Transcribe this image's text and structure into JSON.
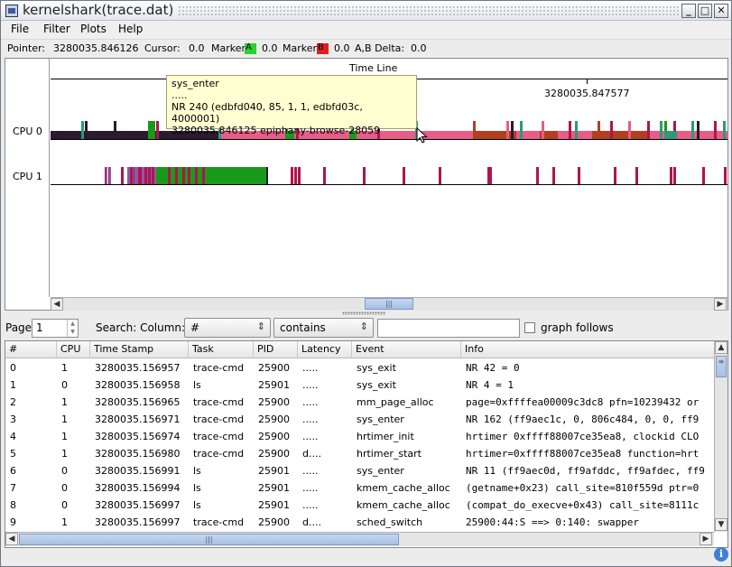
{
  "window": {
    "title": "kernelshark(trace.dat)",
    "controls": {
      "minimize": "_",
      "maximize": "□",
      "close": "✕"
    }
  },
  "menubar": {
    "items": [
      "File",
      "Filter",
      "Plots",
      "Help"
    ]
  },
  "pointer_bar": {
    "pointer_label": "Pointer:",
    "pointer_value": "3280035.846126",
    "cursor_label": "Cursor:",
    "cursor_value": "0.0",
    "marker_a_label": "Marker",
    "marker_a_letter": "A",
    "marker_a_value": "0.0",
    "marker_a_color": "#2fd02f",
    "marker_b_label": "Marker",
    "marker_b_letter": "B",
    "marker_b_value": "0.0",
    "marker_b_color": "#e02020",
    "delta_label": "A,B Delta:",
    "delta_value": "0.0"
  },
  "graph": {
    "timeline_label": "Time Line",
    "tick_label": "3280035.847577",
    "cpus": [
      "CPU 0",
      "CPU 1"
    ],
    "tooltip": {
      "line1": "sys_enter",
      "line2": ".....",
      "line3": "NR 240 (edbfd040, 85, 1, 1, edbfd03c, 4000001)",
      "line4": "3280035.846125 epiphany-browse-28059"
    },
    "colors": {
      "dark": "#2a1b2e",
      "pink": "#e85c85",
      "green": "#1a9a1a",
      "rust": "#b2401f",
      "crimson": "#b0144f",
      "purple": "#8c5aa8",
      "teal": "#2a9a78"
    }
  },
  "search": {
    "page_label": "Page",
    "page_value": "1",
    "search_label": "Search: Column:",
    "column_value": "#",
    "condition_value": "contains",
    "text_value": "",
    "graph_follows_label": "graph follows"
  },
  "table": {
    "headers": [
      "#",
      "CPU",
      "Time Stamp",
      "Task",
      "PID",
      "Latency",
      "Event",
      "Info"
    ],
    "rows": [
      [
        "0",
        "1",
        "3280035.156957",
        "trace-cmd",
        "25900",
        ".....",
        "sys_exit",
        "NR 42 = 0"
      ],
      [
        "1",
        "0",
        "3280035.156958",
        "ls",
        "25901",
        ".....",
        "sys_exit",
        "NR 4 = 1"
      ],
      [
        "2",
        "1",
        "3280035.156965",
        "trace-cmd",
        "25900",
        ".....",
        "mm_page_alloc",
        "page=0xffffea00009c3dc8 pfn=10239432 or"
      ],
      [
        "3",
        "1",
        "3280035.156971",
        "trace-cmd",
        "25900",
        ".....",
        "sys_enter",
        "NR 162 (ff9aec1c, 0, 806c484, 0, 0, ff9"
      ],
      [
        "4",
        "1",
        "3280035.156974",
        "trace-cmd",
        "25900",
        ".....",
        "hrtimer_init",
        "hrtimer 0xffff88007ce35ea8, clockid CLO"
      ],
      [
        "5",
        "1",
        "3280035.156980",
        "trace-cmd",
        "25900",
        "d....",
        "hrtimer_start",
        "hrtimer=0xffff88007ce35ea8 function=hrt"
      ],
      [
        "6",
        "0",
        "3280035.156991",
        "ls",
        "25901",
        ".....",
        "sys_enter",
        "NR 11 (ff9aec0d, ff9afddc, ff9afdec, ff9"
      ],
      [
        "7",
        "0",
        "3280035.156994",
        "ls",
        "25901",
        ".....",
        "kmem_cache_alloc",
        "(getname+0x23) call_site=810f559d ptr=0"
      ],
      [
        "8",
        "0",
        "3280035.156997",
        "ls",
        "25901",
        ".....",
        "kmem_cache_alloc",
        "(compat_do_execve+0x43) call_site=8111c"
      ],
      [
        "9",
        "1",
        "3280035.156997",
        "trace-cmd",
        "25900",
        "d....",
        "sched_switch",
        "25900:44:S ==> 0:140: swapper"
      ]
    ]
  }
}
